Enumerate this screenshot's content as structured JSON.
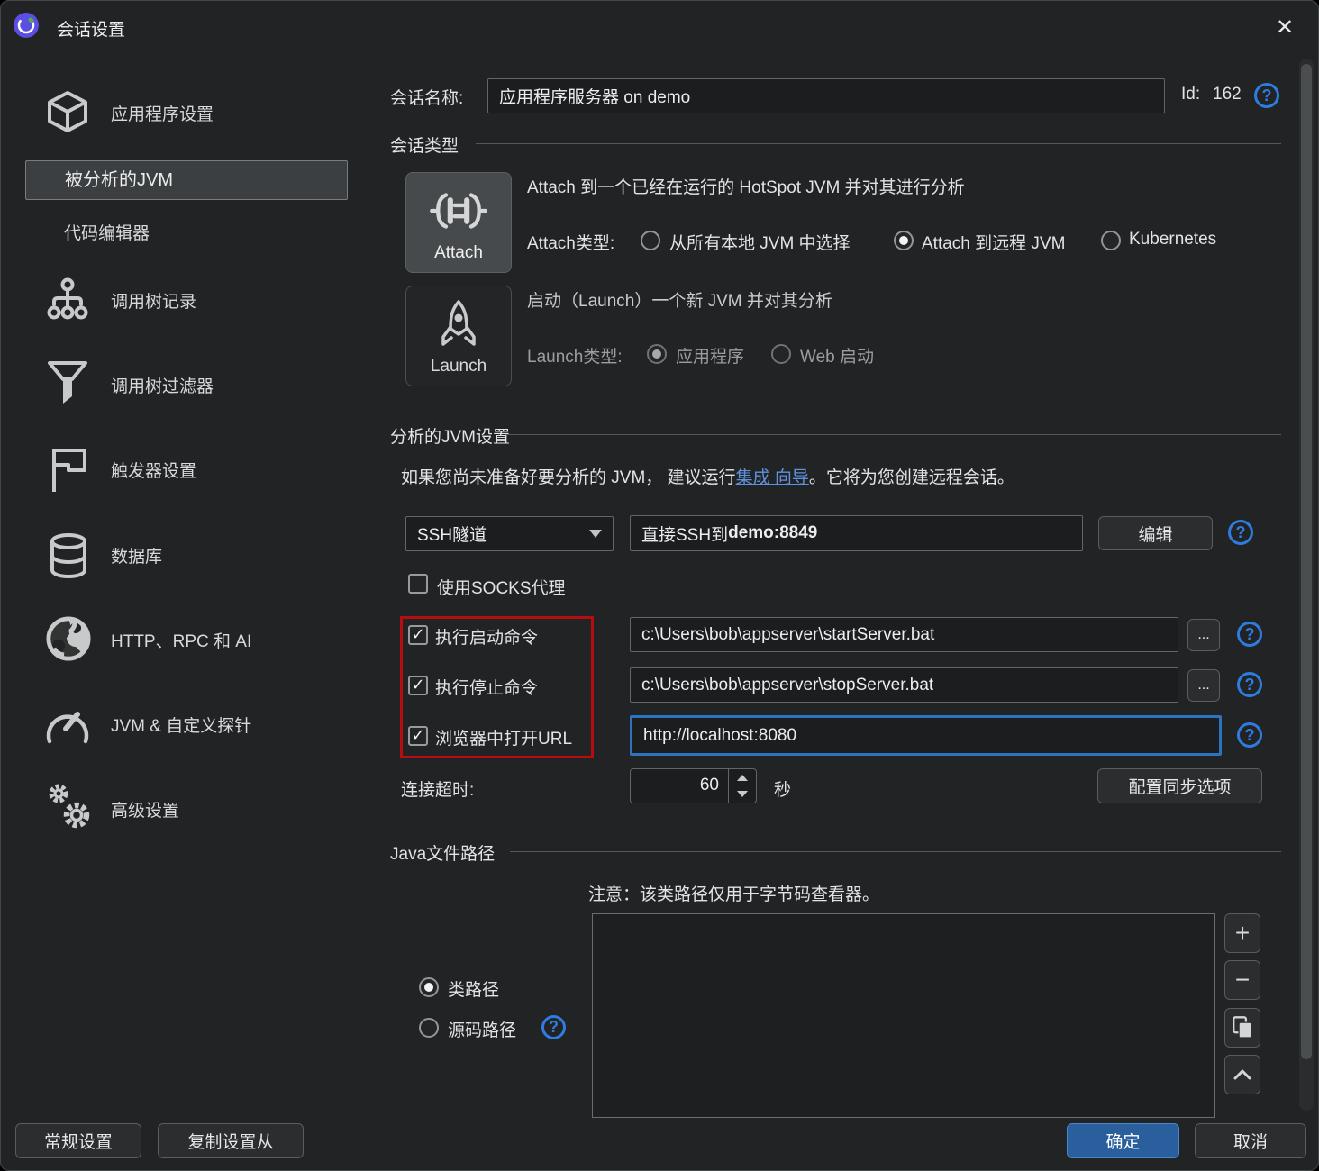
{
  "window": {
    "title": "会话设置",
    "close_glyph": "✕"
  },
  "sidebar": {
    "items": [
      {
        "label": "应用程序设置",
        "icon": "package-icon",
        "selected": false
      },
      {
        "label": "被分析的JVM",
        "icon": null,
        "selected": true
      },
      {
        "label": "代码编辑器",
        "icon": null,
        "selected": false
      },
      {
        "label": "调用树记录",
        "icon": "call-tree-icon",
        "selected": false
      },
      {
        "label": "调用树过滤器",
        "icon": "funnel-icon",
        "selected": false
      },
      {
        "label": "触发器设置",
        "icon": "flag-icon",
        "selected": false
      },
      {
        "label": "数据库",
        "icon": "database-icon",
        "selected": false
      },
      {
        "label": "HTTP、RPC 和 AI",
        "icon": "globe-icon",
        "selected": false
      },
      {
        "label": "JVM & 自定义探针",
        "icon": "gauge-icon",
        "selected": false
      },
      {
        "label": "高级设置",
        "icon": "gears-icon",
        "selected": false
      }
    ]
  },
  "header": {
    "session_name_label": "会话名称:",
    "session_name_value": "应用程序服务器 on demo",
    "id_label": "Id:",
    "id_value": "162"
  },
  "session_type": {
    "section_title": "会话类型",
    "attach": {
      "button_label": "Attach",
      "description": "Attach 到一个已经在运行的 HotSpot JVM 并对其进行分析",
      "type_label": "Attach类型:",
      "options": [
        {
          "label": "从所有本地 JVM 中选择",
          "selected": false
        },
        {
          "label": "Attach 到远程 JVM",
          "selected": true
        },
        {
          "label": "Kubernetes",
          "selected": false
        }
      ]
    },
    "launch": {
      "button_label": "Launch",
      "description": "启动（Launch）一个新 JVM 并对其分析",
      "type_label": "Launch类型:",
      "options": [
        {
          "label": "应用程序",
          "selected": true
        },
        {
          "label": "Web 启动",
          "selected": false
        }
      ]
    }
  },
  "jvm_settings": {
    "section_title": "分析的JVM设置",
    "hint_pre": "如果您尚未准备好要分析的 JVM， 建议运行",
    "hint_link": "集成 向导",
    "hint_post": "。它将为您创建远程会话。",
    "connection_type": "SSH隧道",
    "connection_value_prefix": "直接SSH到 ",
    "connection_value_host": "demo:8849",
    "edit_button": "编辑",
    "socks_checkbox": {
      "label": "使用SOCKS代理",
      "checked": false
    },
    "command_rows": [
      {
        "label": "执行启动命令",
        "checked": true,
        "value": "c:\\Users\\bob\\appserver\\startServer.bat",
        "browse": "..."
      },
      {
        "label": "执行停止命令",
        "checked": true,
        "value": "c:\\Users\\bob\\appserver\\stopServer.bat",
        "browse": "..."
      },
      {
        "label": "浏览器中打开URL",
        "checked": true,
        "value": "http://localhost:8080"
      }
    ],
    "timeout_label": "连接超时:",
    "timeout_value": "60",
    "timeout_unit": "秒",
    "sync_button": "配置同步选项"
  },
  "java_paths": {
    "section_title": "Java文件路径",
    "note": "注意：该类路径仅用于字节码查看器。",
    "options": [
      {
        "label": "类路径",
        "selected": true
      },
      {
        "label": "源码路径",
        "selected": false
      }
    ],
    "list_items": []
  },
  "footer": {
    "general_button": "常规设置",
    "copy_button": "复制设置从",
    "ok_button": "确定",
    "cancel_button": "取消"
  },
  "glyphs": {
    "check": "✓",
    "dot": "",
    "browse": "...",
    "plus": "+",
    "minus": "−",
    "question": "?"
  },
  "colors": {
    "accent_blue": "#2a5f9e",
    "help_blue": "#2f7ce0",
    "link_blue": "#5e92dc",
    "highlight_red": "#b80d10",
    "focus_blue": "#2d73c0"
  }
}
